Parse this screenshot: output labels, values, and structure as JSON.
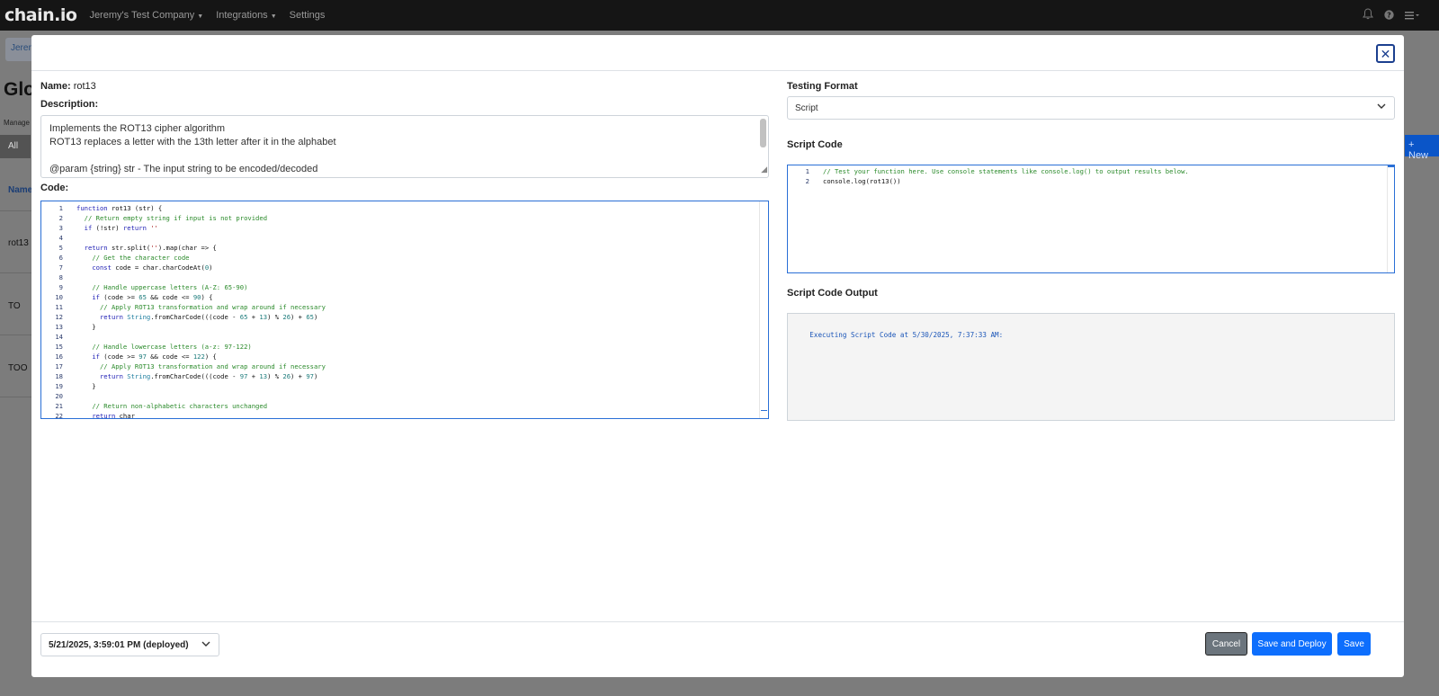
{
  "topnav": {
    "logo": "chain.io",
    "company": "Jeremy's Test Company",
    "integrations": "Integrations",
    "settings": "Settings"
  },
  "background": {
    "breadcrumb": "Jerem",
    "title": "Glo",
    "manage": "Manage",
    "all_tab": "All",
    "new_button": "+ New",
    "col_name": "Name",
    "rows": [
      "rot13",
      "TO",
      "TOO"
    ]
  },
  "modal": {
    "name_label": "Name:",
    "name_value": "rot13",
    "description_label": "Description:",
    "description_lines": [
      "Implements the ROT13 cipher algorithm",
      "ROT13 replaces a letter with the 13th letter after it in the alphabet",
      "",
      "@param {string} str - The input string to be encoded/decoded"
    ],
    "code_label": "Code:",
    "code_lines": [
      "function rot13 (str) {",
      "  // Return empty string if input is not provided",
      "  if (!str) return ''",
      "",
      "  return str.split('').map(char => {",
      "    // Get the character code",
      "    const code = char.charCodeAt(0)",
      "",
      "    // Handle uppercase letters (A-Z: 65-90)",
      "    if (code >= 65 && code <= 90) {",
      "      // Apply ROT13 transformation and wrap around if necessary",
      "      return String.fromCharCode(((code - 65 + 13) % 26) + 65)",
      "    }",
      "",
      "    // Handle lowercase letters (a-z: 97-122)",
      "    if (code >= 97 && code <= 122) {",
      "      // Apply ROT13 transformation and wrap around if necessary",
      "      return String.fromCharCode(((code - 97 + 13) % 26) + 97)",
      "    }",
      "",
      "    // Return non-alphabetic characters unchanged",
      "    return char"
    ],
    "testing_format_label": "Testing Format",
    "testing_format_value": "Script",
    "script_code_label": "Script Code",
    "script_lines": [
      "// Test your function here. Use console statements like console.log() to output results below.",
      "console.log(rot13())"
    ],
    "script_output_label": "Script Code Output",
    "script_output_text": "Executing Script Code at 5/30/2025, 7:37:33 AM:",
    "version_value": "5/21/2025, 3:59:01 PM (deployed)",
    "cancel_label": "Cancel",
    "save_deploy_label": "Save and Deploy",
    "save_label": "Save"
  },
  "colors": {
    "primary": "#0d6efd",
    "secondary": "#6c757d",
    "focus_border": "#2a6fd6",
    "comment": "#2a8a2a",
    "keyword": "#1e1eb4"
  }
}
